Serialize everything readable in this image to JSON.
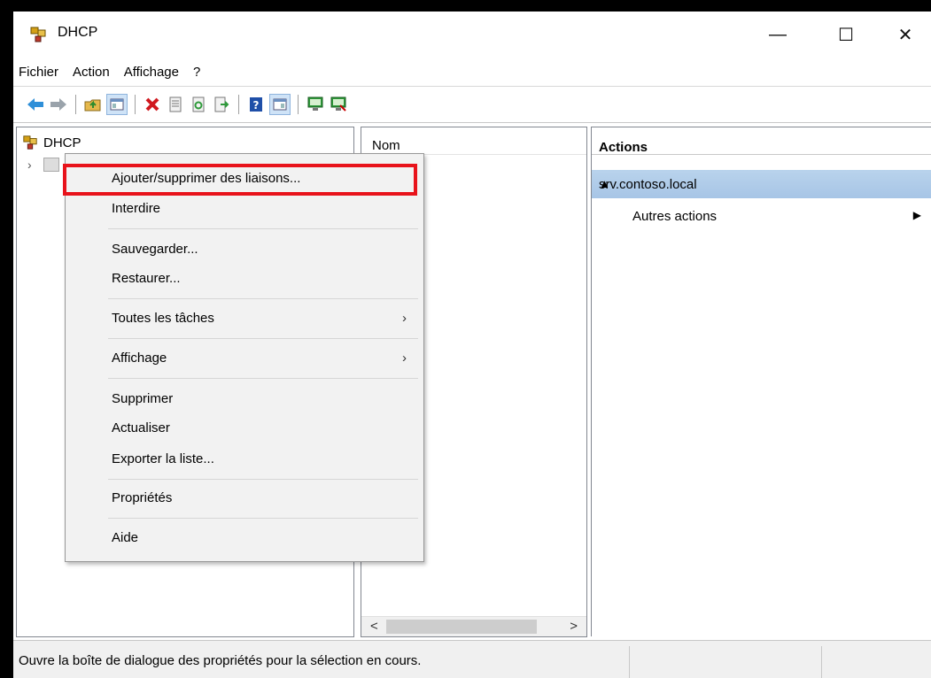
{
  "window": {
    "title": "DHCP",
    "minimize": "—",
    "maximize": "☐",
    "close": "✕"
  },
  "menubar": [
    "Fichier",
    "Action",
    "Affichage",
    "?"
  ],
  "tree": {
    "root": "DHCP"
  },
  "list": {
    "column_name": "Nom"
  },
  "actions": {
    "header": "Actions",
    "server": "srv.contoso.local",
    "more": "Autres actions"
  },
  "context_menu": {
    "items": [
      "Ajouter/supprimer des liaisons...",
      "Interdire",
      "Sauvegarder...",
      "Restaurer...",
      "Toutes les tâches",
      "Affichage",
      "Supprimer",
      "Actualiser",
      "Exporter la liste...",
      "Propriétés",
      "Aide"
    ],
    "highlighted_color": "#e8131b"
  },
  "statusbar": {
    "text": "Ouvre la boîte de dialogue des propriétés pour la sélection en cours."
  },
  "colors": {
    "selection": "#b9d3ec",
    "menu_bg": "#f2f2f2"
  }
}
